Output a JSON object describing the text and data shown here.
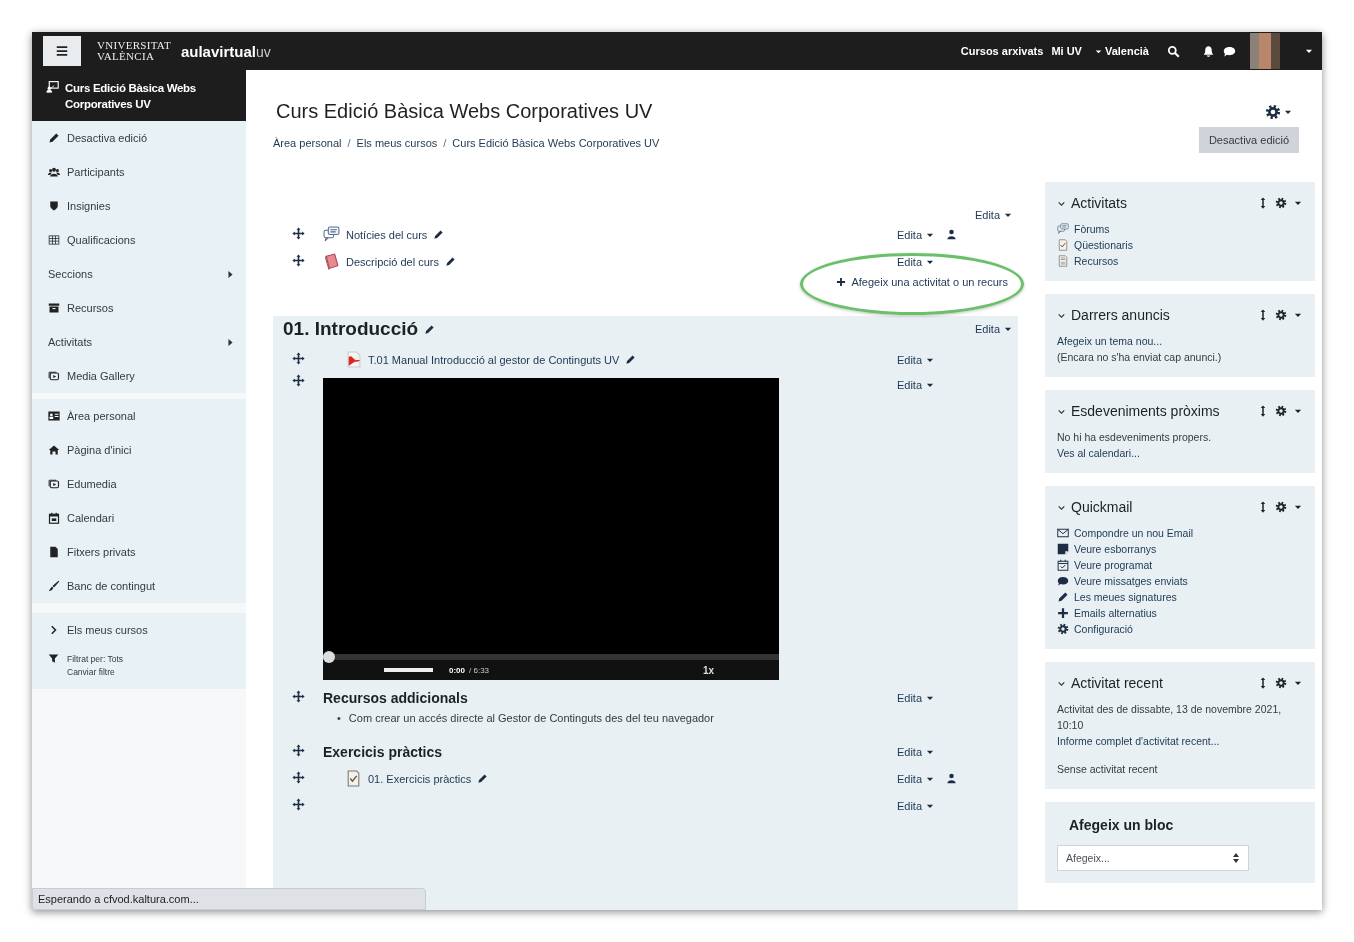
{
  "navbar": {
    "university_logo": [
      "VNIVERSITAT",
      "VALÈNCIA"
    ],
    "site_logo": [
      "aulavirtual",
      "uv"
    ],
    "links": [
      "Cursos arxivats",
      "Mi UV"
    ],
    "language": "Valencià"
  },
  "sidebar": {
    "course_title": "Curs Edició Bàsica Webs Corporatives UV",
    "groups": [
      [
        {
          "kind": "link",
          "label": "Desactiva edició",
          "submenu": false
        },
        {
          "kind": "link",
          "label": "Participants",
          "submenu": false
        },
        {
          "kind": "link",
          "label": "Insignies",
          "submenu": false
        },
        {
          "kind": "link",
          "label": "Qualificacions",
          "submenu": false
        },
        {
          "kind": "link",
          "label": "Seccions",
          "submenu": true
        },
        {
          "kind": "link",
          "label": "Recursos",
          "submenu": false
        },
        {
          "kind": "link",
          "label": "Activitats",
          "submenu": true
        },
        {
          "kind": "link",
          "label": "Media Gallery",
          "submenu": false
        }
      ],
      [
        {
          "kind": "link",
          "label": "Àrea personal",
          "submenu": false
        },
        {
          "kind": "link",
          "label": "Pàgina d'inici",
          "submenu": false
        },
        {
          "kind": "link",
          "label": "Edumedia",
          "submenu": false
        },
        {
          "kind": "link",
          "label": "Calendari",
          "submenu": false
        },
        {
          "kind": "link",
          "label": "Fitxers privats",
          "submenu": false
        },
        {
          "kind": "link",
          "label": "Banc de contingut",
          "submenu": false
        }
      ],
      [
        {
          "kind": "link",
          "label": "Els meus cursos",
          "submenu": false
        },
        {
          "kind": "filter",
          "lines": [
            "Filtrat per: Tots",
            "Canviar filtre"
          ]
        }
      ]
    ]
  },
  "page": {
    "title": "Curs Edició Bàsica Webs Corporatives UV",
    "breadcrumb": [
      "Àrea personal",
      "Els meus cursos",
      "Curs Edició Bàsica Webs Corporatives UV"
    ],
    "breadcrumb_separator": "/",
    "edit_button": "Desactiva edició"
  },
  "sections": [
    {
      "edit": "Edita",
      "add_activity": "Afegeix una activitat o un recurs",
      "rows": [
        {
          "kind": "activity",
          "label": "Notícies del curs",
          "edit": "Edita",
          "restricted": true
        },
        {
          "kind": "activity",
          "label": "Descripció del curs",
          "edit": "Edita",
          "restricted": false
        }
      ]
    },
    {
      "title": "01. Introducció",
      "edit": "Edita",
      "rows": [
        {
          "kind": "activity",
          "label": "T.01 Manual Introducció al gestor de Continguts UV",
          "edit": "Edita",
          "restricted": false
        },
        {
          "kind": "video",
          "edit": "Edita",
          "restricted": false,
          "time": "0:00",
          "duration": "/ 6:33",
          "speed": "1x",
          "progress": {
            "level": 0
          },
          "volume": {
            "level": 1
          }
        },
        {
          "kind": "label",
          "label": "Recursos addicionals",
          "edit": "Edita",
          "restricted": false,
          "bullet_marker": "•",
          "bullets": [
            "Com crear un accés directe al Gestor de Continguts des del teu navegador"
          ]
        },
        {
          "kind": "label",
          "label": "Exercicis pràctics",
          "edit": "Edita",
          "restricted": false
        },
        {
          "kind": "activity",
          "label": "01. Exercicis pràctics",
          "edit": "Edita",
          "restricted": true
        },
        {
          "kind": "empty",
          "edit": "Edita",
          "restricted": false
        }
      ]
    }
  ],
  "blocks": [
    {
      "kind": "links",
      "title": "Activitats",
      "items": [
        "Fòrums",
        "Qüestionaris",
        "Recursos"
      ]
    },
    {
      "kind": "text",
      "title": "Darrers anuncis",
      "paragraphs": [
        [
          {
            "text": "Afegeix un tema nou...",
            "link": true
          },
          {
            "text": "(Encara no s'ha enviat cap anunci.)",
            "link": false
          }
        ]
      ]
    },
    {
      "kind": "text",
      "title": "Esdeveniments pròxims",
      "paragraphs": [
        [
          {
            "text": "No hi ha esdeveniments propers.",
            "link": false
          },
          {
            "text": "Ves al calendari...",
            "link": true
          }
        ]
      ]
    },
    {
      "kind": "links",
      "title": "Quickmail",
      "items": [
        "Compondre un nou Email",
        "Veure esborranys",
        "Veure programat",
        "Veure missatges enviats",
        "Les meues signatures",
        "Emails alternatius",
        "Configuració"
      ]
    },
    {
      "kind": "text",
      "title": "Activitat recent",
      "paragraphs": [
        [
          {
            "text": "Activitat des de dissabte, 13 de novembre 2021, 10:10",
            "link": false
          },
          {
            "text": "Informe complet d'activitat recent...",
            "link": true
          }
        ],
        [
          {
            "text": "Sense activitat recent",
            "link": false
          }
        ]
      ]
    },
    {
      "kind": "add",
      "title": "Afegeix un bloc",
      "select": "Afegeix..."
    }
  ],
  "status_bar": "Esperando a cfvod.kaltura.com..."
}
